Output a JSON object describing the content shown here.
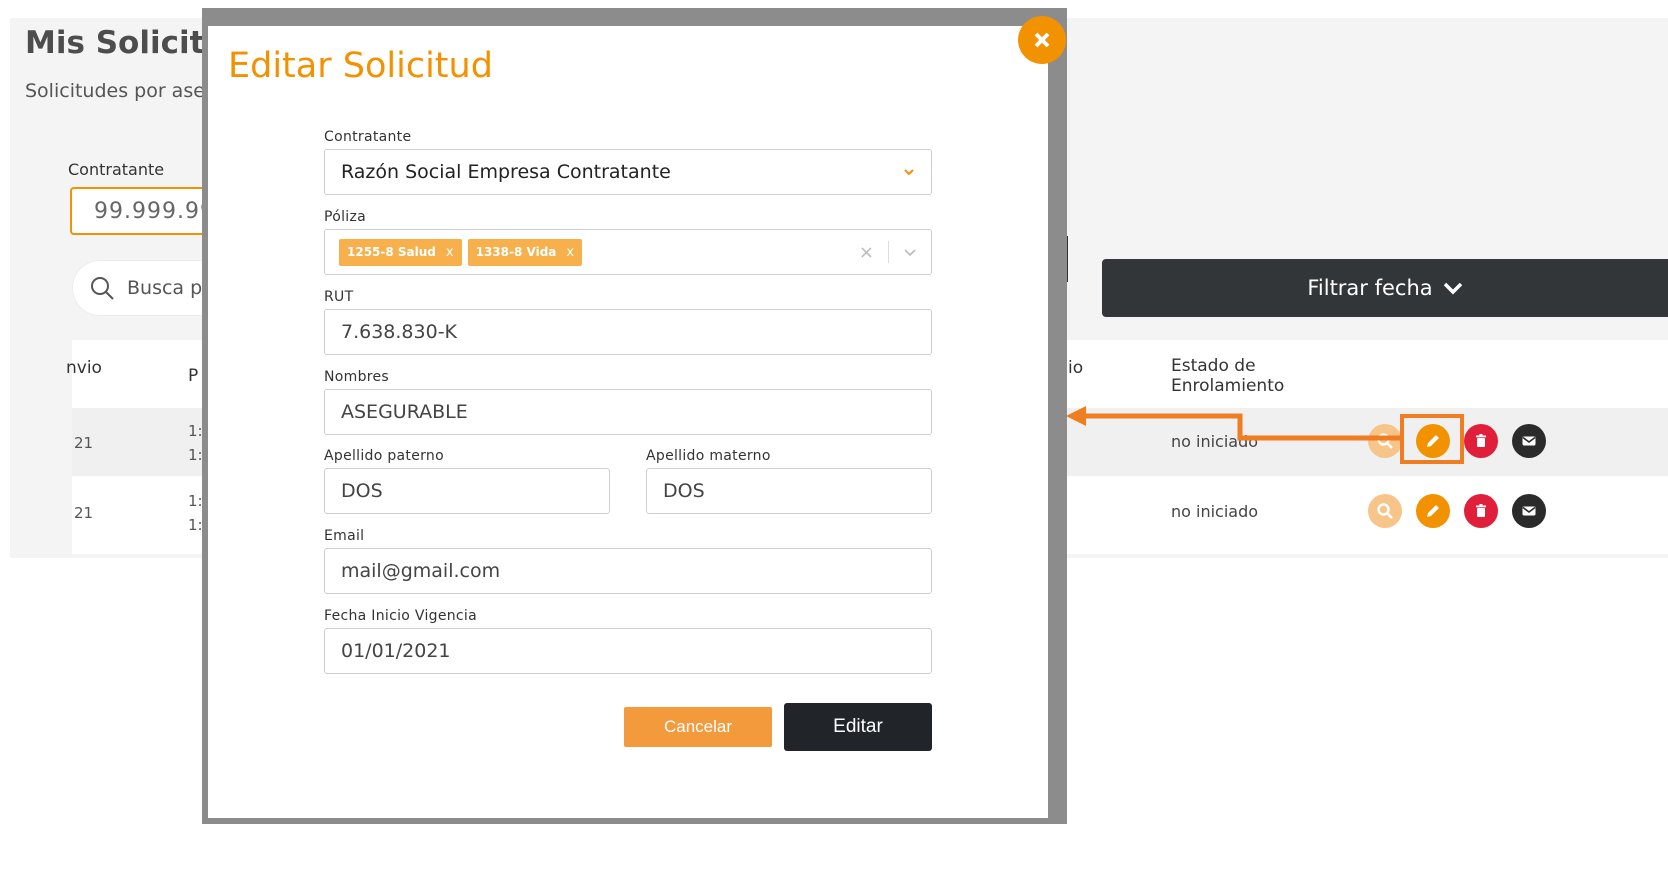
{
  "background": {
    "title": "Mis Solicit",
    "subtitle": "Solicitudes por ase",
    "contratante_label": "Contratante",
    "contratante_value": "99.999.99",
    "search_placeholder": "Busca p",
    "filter_button": "Filtrar fecha",
    "table": {
      "col_envio": "nvio",
      "col_p": "P",
      "col_fecha_envio_tail": "io",
      "col_estado": "Estado de Enrolamiento",
      "rows": [
        {
          "date_tail": "21",
          "p_top": "1:",
          "p_bottom": "1:",
          "status": "no iniciado"
        },
        {
          "date_tail": "21",
          "p_top": "1:",
          "p_bottom": "1:",
          "status": "no iniciado"
        }
      ]
    }
  },
  "modal": {
    "title": "Editar Solicitud",
    "fields": {
      "contratante": {
        "label": "Contratante",
        "value": "Razón Social Empresa Contratante"
      },
      "poliza": {
        "label": "Póliza",
        "tags": [
          "1255-8 Salud",
          "1338-8 Vida"
        ],
        "remove_glyph": "x",
        "clear_glyph": "×"
      },
      "rut": {
        "label": "RUT",
        "value": "7.638.830-K"
      },
      "nombres": {
        "label": "Nombres",
        "value": "ASEGURABLE"
      },
      "apellido_paterno": {
        "label": "Apellido paterno",
        "value": "DOS"
      },
      "apellido_materno": {
        "label": "Apellido materno",
        "value": "DOS"
      },
      "email": {
        "label": "Email",
        "value": "mail@gmail.com"
      },
      "fecha_inicio": {
        "label": "Fecha Inicio Vigencia",
        "value": "01/01/2021"
      }
    },
    "buttons": {
      "cancel": "Cancelar",
      "edit": "Editar"
    }
  },
  "colors": {
    "accent": "#f39200",
    "danger": "#e0203a",
    "dark": "#212529",
    "arrow": "#ef7d22"
  },
  "icons": [
    "close-icon",
    "search-icon",
    "chevron-down-icon",
    "magnifier-icon",
    "pencil-icon",
    "trash-icon",
    "envelope-icon"
  ]
}
